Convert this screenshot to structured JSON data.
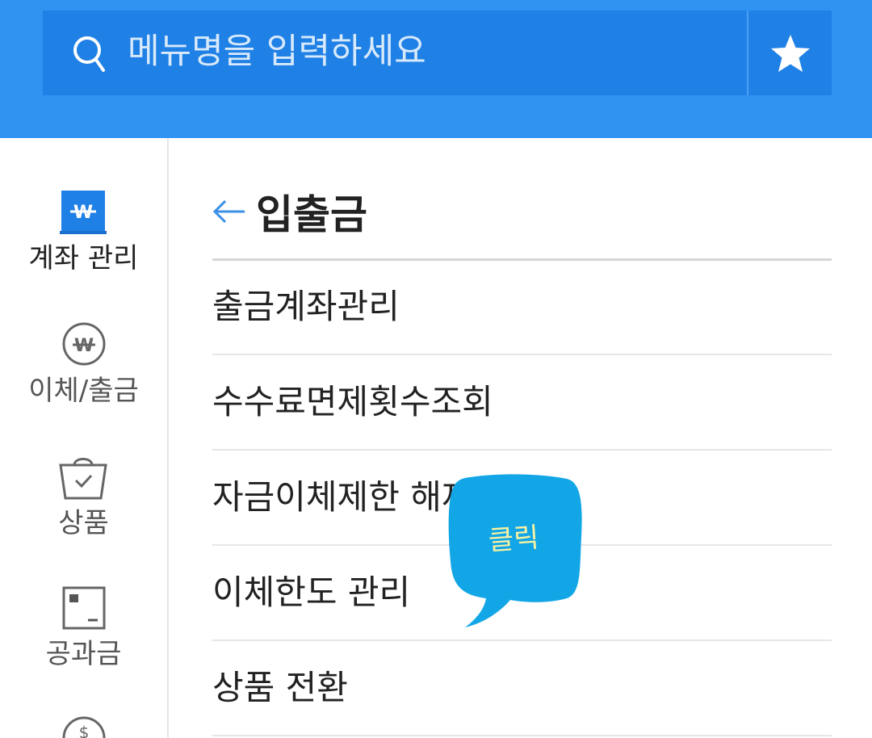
{
  "header": {
    "search_placeholder": "메뉴명을 입력하세요",
    "search_icon": "search-icon",
    "favorite_icon": "star-icon",
    "bg_color": "#3093f2",
    "bar_color": "#1f80e5"
  },
  "sidebar": {
    "items": [
      {
        "label": "계좌 관리",
        "icon": "won-card-icon",
        "active": true
      },
      {
        "label": "이체/출금",
        "icon": "won-circle-icon",
        "active": false
      },
      {
        "label": "상품",
        "icon": "shopping-bag-icon",
        "active": false
      },
      {
        "label": "공과금",
        "icon": "bill-icon",
        "active": false
      },
      {
        "label": "",
        "icon": "dollar-circle-icon",
        "active": false
      }
    ]
  },
  "main": {
    "title": "입출금",
    "back_icon": "back-arrow-icon",
    "menu": [
      {
        "label": "출금계좌관리"
      },
      {
        "label": "수수료면제횟수조회"
      },
      {
        "label": "자금이체제한 해제"
      },
      {
        "label": "이체한도 관리"
      },
      {
        "label": "상품 전환"
      }
    ]
  },
  "overlay": {
    "bubble_text": "클릭",
    "bubble_color": "#12a6e6"
  }
}
